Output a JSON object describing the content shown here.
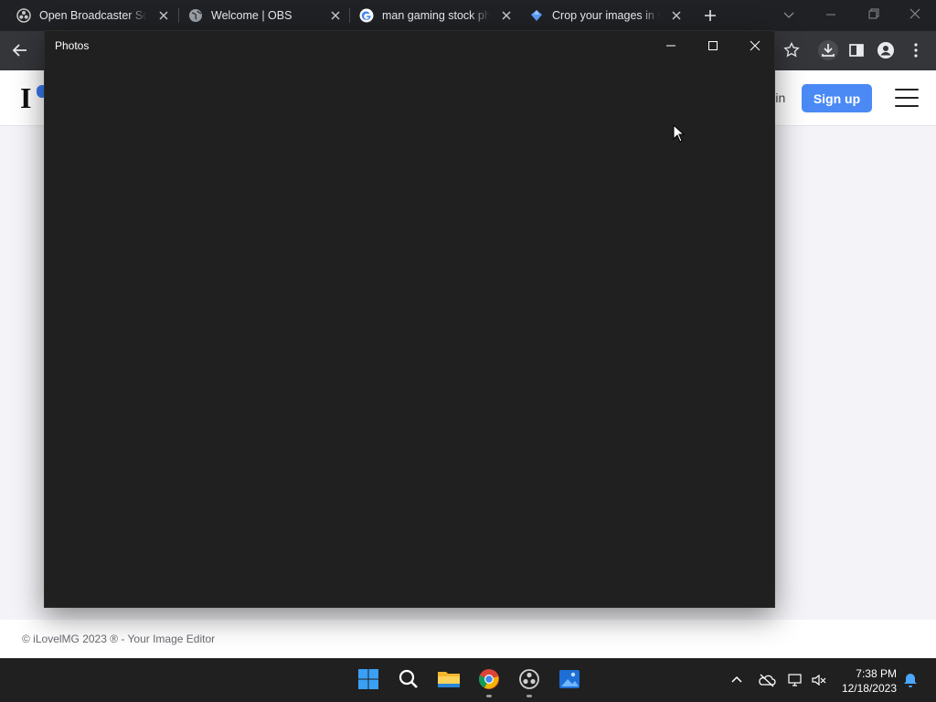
{
  "browser": {
    "tabs": [
      {
        "title": "Open Broadcaster Software",
        "icon": "obs-icon"
      },
      {
        "title": "Welcome | OBS",
        "icon": "globe-icon"
      },
      {
        "title": "man gaming stock photos",
        "icon": "google-icon"
      },
      {
        "title": "Crop your images in seconds",
        "icon": "iloveimg-icon",
        "active": true
      }
    ],
    "new_tab_icon": "plus-icon"
  },
  "site": {
    "logo_letter": "I",
    "login_label": "Login",
    "signup_label": "Sign up",
    "accent_color": "#4b8af5",
    "footer_text": "© iLovelMG 2023 ® - Your Image Editor"
  },
  "photos_window": {
    "title": "Photos",
    "background": "#202020"
  },
  "taskbar": {
    "apps": [
      "start-icon",
      "search-icon",
      "file-explorer-icon",
      "chrome-icon",
      "obs-icon",
      "photos-icon"
    ],
    "tray": [
      "chevron-up-icon",
      "onedrive-icon",
      "network-icon",
      "volume-icon",
      "notification-bell-icon"
    ],
    "time": "7:38 PM",
    "date": "12/18/2023"
  }
}
